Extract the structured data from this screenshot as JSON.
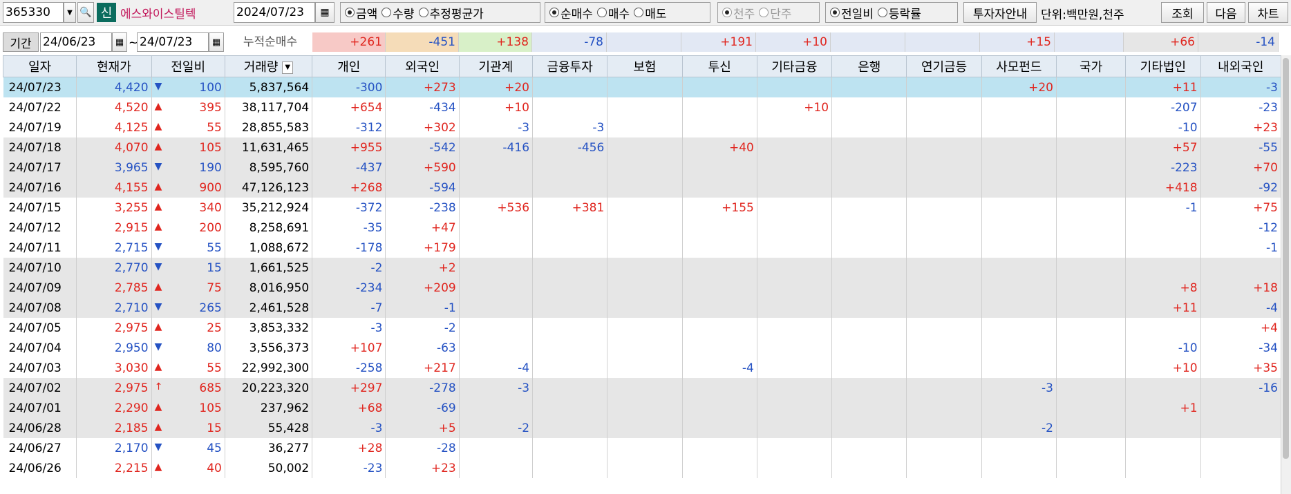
{
  "toolbar": {
    "code": "365330",
    "badge": "신",
    "stock_name": "에스와이스틸텍",
    "date": "2024/07/23",
    "group1": [
      "금액",
      "수량",
      "추정평균가"
    ],
    "group2": [
      "순매수",
      "매수",
      "매도"
    ],
    "group3": [
      "천주",
      "단주"
    ],
    "group4": [
      "전일비",
      "등락률"
    ],
    "invest_guide": "투자자안내",
    "unit": "단위:백만원,천주",
    "query": "조회",
    "next": "다음",
    "chart": "차트"
  },
  "period": {
    "label": "기간",
    "from": "24/06/23",
    "sep": "~",
    "to": "24/07/23",
    "cum_label": "누적순매수",
    "sums": [
      "+261",
      "-451",
      "+138",
      "-78",
      "",
      "+191",
      "+10",
      "",
      "",
      "+15",
      "",
      "+66",
      "-14"
    ]
  },
  "columns": [
    "일자",
    "현재가",
    "전일비",
    "거래량",
    "개인",
    "외국인",
    "기관계",
    "금융투자",
    "보험",
    "투신",
    "기타금융",
    "은행",
    "연기금등",
    "사모펀드",
    "국가",
    "기타법인",
    "내외국인"
  ],
  "rows": [
    [
      "24/07/23",
      "4,420",
      "▼",
      "100",
      "5,837,564",
      "-300",
      "+273",
      "+20",
      "",
      "",
      "",
      "",
      "",
      "",
      "+20",
      "",
      "+11",
      "-3"
    ],
    [
      "24/07/22",
      "4,520",
      "▲",
      "395",
      "38,117,704",
      "+654",
      "-434",
      "+10",
      "",
      "",
      "",
      "+10",
      "",
      "",
      "",
      "",
      "-207",
      "-23"
    ],
    [
      "24/07/19",
      "4,125",
      "▲",
      "55",
      "28,855,583",
      "-312",
      "+302",
      "-3",
      "-3",
      "",
      "",
      "",
      "",
      "",
      "",
      "",
      "-10",
      "+23"
    ],
    [
      "24/07/18",
      "4,070",
      "▲",
      "105",
      "11,631,465",
      "+955",
      "-542",
      "-416",
      "-456",
      "",
      "+40",
      "",
      "",
      "",
      "",
      "",
      "+57",
      "-55"
    ],
    [
      "24/07/17",
      "3,965",
      "▼",
      "190",
      "8,595,760",
      "-437",
      "+590",
      "",
      "",
      "",
      "",
      "",
      "",
      "",
      "",
      "",
      "-223",
      "+70"
    ],
    [
      "24/07/16",
      "4,155",
      "▲",
      "900",
      "47,126,123",
      "+268",
      "-594",
      "",
      "",
      "",
      "",
      "",
      "",
      "",
      "",
      "",
      "+418",
      "-92"
    ],
    [
      "24/07/15",
      "3,255",
      "▲",
      "340",
      "35,212,924",
      "-372",
      "-238",
      "+536",
      "+381",
      "",
      "+155",
      "",
      "",
      "",
      "",
      "",
      "-1",
      "+75"
    ],
    [
      "24/07/12",
      "2,915",
      "▲",
      "200",
      "8,258,691",
      "-35",
      "+47",
      "",
      "",
      "",
      "",
      "",
      "",
      "",
      "",
      "",
      "",
      "-12"
    ],
    [
      "24/07/11",
      "2,715",
      "▼",
      "55",
      "1,088,672",
      "-178",
      "+179",
      "",
      "",
      "",
      "",
      "",
      "",
      "",
      "",
      "",
      "",
      "-1"
    ],
    [
      "24/07/10",
      "2,770",
      "▼",
      "15",
      "1,661,525",
      "-2",
      "+2",
      "",
      "",
      "",
      "",
      "",
      "",
      "",
      "",
      "",
      "",
      ""
    ],
    [
      "24/07/09",
      "2,785",
      "▲",
      "75",
      "8,016,950",
      "-234",
      "+209",
      "",
      "",
      "",
      "",
      "",
      "",
      "",
      "",
      "",
      "+8",
      "+18"
    ],
    [
      "24/07/08",
      "2,710",
      "▼",
      "265",
      "2,461,528",
      "-7",
      "-1",
      "",
      "",
      "",
      "",
      "",
      "",
      "",
      "",
      "",
      "+11",
      "-4"
    ],
    [
      "24/07/05",
      "2,975",
      "▲",
      "25",
      "3,853,332",
      "-3",
      "-2",
      "",
      "",
      "",
      "",
      "",
      "",
      "",
      "",
      "",
      "",
      "+4"
    ],
    [
      "24/07/04",
      "2,950",
      "▼",
      "80",
      "3,556,373",
      "+107",
      "-63",
      "",
      "",
      "",
      "",
      "",
      "",
      "",
      "",
      "",
      "-10",
      "-34"
    ],
    [
      "24/07/03",
      "3,030",
      "▲",
      "55",
      "22,992,300",
      "-258",
      "+217",
      "-4",
      "",
      "",
      "-4",
      "",
      "",
      "",
      "",
      "",
      "+10",
      "+35"
    ],
    [
      "24/07/02",
      "2,975",
      "↑",
      "685",
      "20,223,320",
      "+297",
      "-278",
      "-3",
      "",
      "",
      "",
      "",
      "",
      "",
      "-3",
      "",
      "",
      "-16"
    ],
    [
      "24/07/01",
      "2,290",
      "▲",
      "105",
      "237,962",
      "+68",
      "-69",
      "",
      "",
      "",
      "",
      "",
      "",
      "",
      "",
      "",
      "+1",
      ""
    ],
    [
      "24/06/28",
      "2,185",
      "▲",
      "15",
      "55,428",
      "-3",
      "+5",
      "-2",
      "",
      "",
      "",
      "",
      "",
      "",
      "-2",
      "",
      "",
      ""
    ],
    [
      "24/06/27",
      "2,170",
      "▼",
      "45",
      "36,277",
      "+28",
      "-28",
      "",
      "",
      "",
      "",
      "",
      "",
      "",
      "",
      "",
      "",
      ""
    ],
    [
      "24/06/26",
      "2,215",
      "▲",
      "40",
      "50,002",
      "-23",
      "+23",
      "",
      "",
      "",
      "",
      "",
      "",
      "",
      "",
      "",
      "",
      ""
    ]
  ],
  "row_shading": [
    "sel",
    "",
    "",
    "g",
    "g",
    "g",
    "",
    "",
    "",
    "g",
    "g",
    "g",
    "",
    "",
    "",
    "g",
    "g",
    "g",
    "",
    ""
  ],
  "colors": {
    "up": "#e0261f",
    "down": "#2552c3",
    "selected": "#bde3f1",
    "header": "#e4ecf4",
    "shaded": "#e6e6e6"
  }
}
